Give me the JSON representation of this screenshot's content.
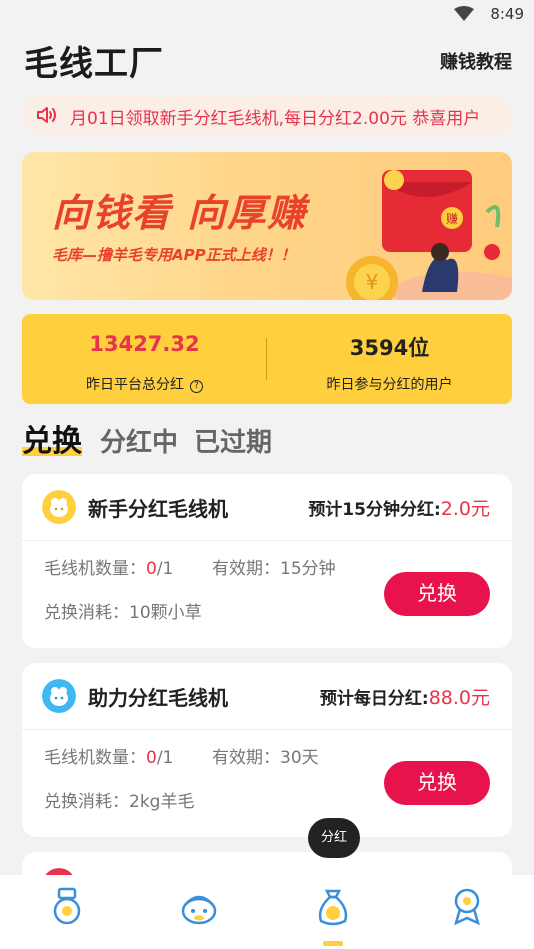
{
  "status": {
    "time": "8:49"
  },
  "header": {
    "title": "毛线工厂",
    "tutorial": "赚钱教程"
  },
  "marquee": {
    "text": "月01日领取新手分红毛线机,每日分红2.00元  恭喜用户"
  },
  "banner": {
    "headline": "向钱看 向厚赚",
    "subline": "毛库—撸羊毛专用APP正式上线！！",
    "badge": "赚"
  },
  "stats": {
    "total_value": "13427.32",
    "total_label": "昨日平台总分红",
    "users_value": "3594位",
    "users_label": "昨日参与分红的用户"
  },
  "tabs": [
    {
      "label": "兑换",
      "active": true
    },
    {
      "label": "分红中",
      "active": false
    },
    {
      "label": "已过期",
      "active": false
    }
  ],
  "cards": [
    {
      "name": "新手分红毛线机",
      "estimate_label": "预计15分钟分红:",
      "estimate_amount": "2.0元",
      "count_label": "毛线机数量：",
      "count_have": "0",
      "count_total": "/1",
      "validity": "有效期：15分钟",
      "cost": "兑换消耗：10颗小草",
      "button": "兑换",
      "icon": "yellow-sheep-icon",
      "icon_color": "#ffcf3d"
    },
    {
      "name": "助力分红毛线机",
      "estimate_label": "预计每日分红:",
      "estimate_amount": "88.0元",
      "count_label": "毛线机数量：",
      "count_have": "0",
      "count_total": "/1",
      "validity": "有效期：30天",
      "cost": "兑换消耗：2kg羊毛",
      "button": "兑换",
      "icon": "blue-sheep-icon",
      "icon_color": "#3fb8f2"
    }
  ],
  "tooltip": "分红",
  "nav": [
    {
      "icon": "medal-icon"
    },
    {
      "icon": "sheep-face-icon"
    },
    {
      "icon": "money-bag-icon",
      "active": true
    },
    {
      "icon": "profile-icon"
    }
  ],
  "colors": {
    "accent": "#ffcf3d",
    "red": "#e8334d",
    "button": "#e8124d"
  }
}
